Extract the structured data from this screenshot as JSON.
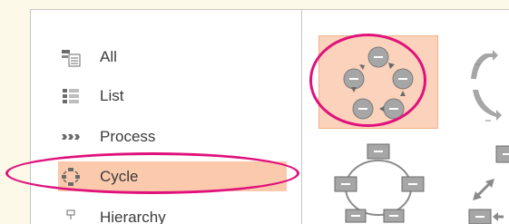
{
  "categories": [
    {
      "label": "All",
      "icon": "all-icon"
    },
    {
      "label": "List",
      "icon": "list-icon"
    },
    {
      "label": "Process",
      "icon": "process-icon"
    },
    {
      "label": "Cycle",
      "icon": "cycle-icon"
    },
    {
      "label": "Hierarchy",
      "icon": "hierarchy-icon"
    }
  ],
  "selected_category": "Cycle",
  "layouts": [
    {
      "name": "basic-cycle",
      "selected": true
    },
    {
      "name": "segmented-cycle",
      "selected": false
    },
    {
      "name": "block-cycle",
      "selected": false
    },
    {
      "name": "multidirectional-cycle",
      "selected": false
    }
  ],
  "colors": {
    "selection": "#fbc9ac",
    "highlight_ring": "#e0117b",
    "shape_fill": "#a6a6a6",
    "page_background": "#fdf9e8"
  }
}
